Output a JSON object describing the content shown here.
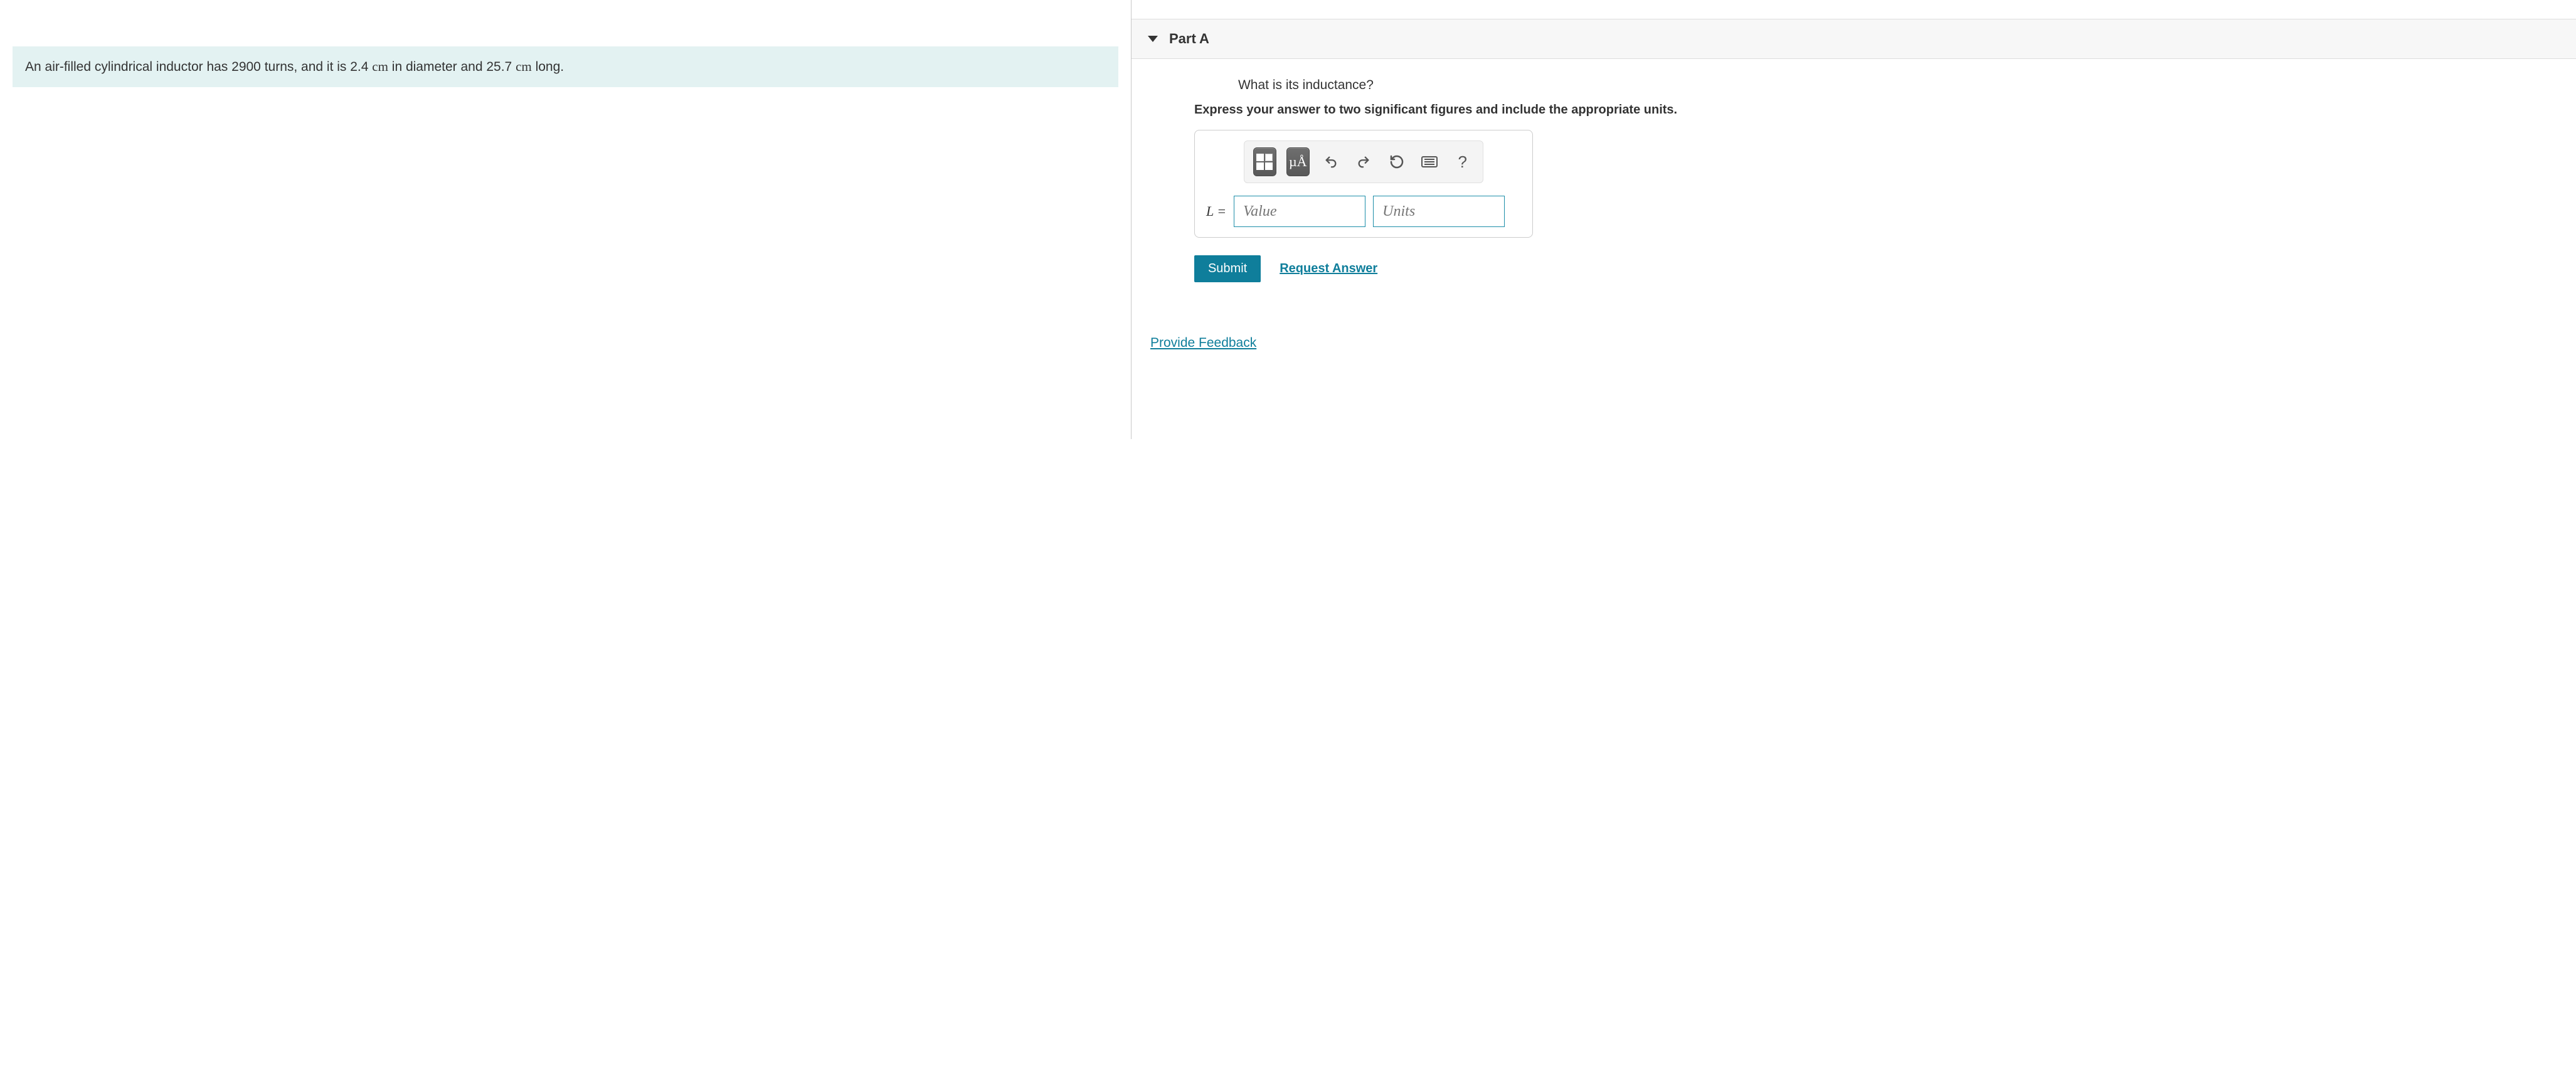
{
  "problem": {
    "statement_prefix": "An air-filled cylindrical inductor has 2900 turns, and it is 2.4 ",
    "unit1": "cm",
    "statement_mid": " in diameter and 25.7 ",
    "unit2": "cm",
    "statement_suffix": " long."
  },
  "part": {
    "label": "Part A",
    "question": "What is its inductance?",
    "instruction": "Express your answer to two significant figures and include the appropriate units."
  },
  "toolbar": {
    "templates_label": "templates",
    "symbols_label": "µÅ",
    "undo_label": "undo",
    "redo_label": "redo",
    "reset_label": "reset",
    "keyboard_label": "keyboard",
    "help_label": "?"
  },
  "answer": {
    "variable": "L =",
    "value_placeholder": "Value",
    "units_placeholder": "Units"
  },
  "buttons": {
    "submit": "Submit",
    "request_answer": "Request Answer"
  },
  "footer": {
    "provide_feedback": "Provide Feedback"
  }
}
